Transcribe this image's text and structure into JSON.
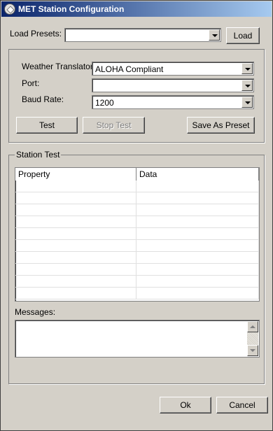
{
  "window": {
    "title": "MET Station Configuration"
  },
  "presets": {
    "label": "Load Presets:",
    "value": "",
    "load_button": "Load"
  },
  "config": {
    "weather_translator_label": "Weather Translator:",
    "weather_translator_value": "ALOHA Compliant",
    "port_label": "Port:",
    "port_value": "",
    "baud_rate_label": "Baud Rate:",
    "baud_rate_value": "1200",
    "test_button": "Test",
    "stop_test_button": "Stop Test",
    "save_preset_button": "Save As Preset"
  },
  "station_test": {
    "legend": "Station Test",
    "columns": [
      "Property",
      "Data"
    ],
    "row_count": 10,
    "messages_label": "Messages:"
  },
  "footer": {
    "ok_button": "Ok",
    "cancel_button": "Cancel"
  },
  "colors": {
    "window_bg": "#d4d0c8",
    "title_start": "#0a246a",
    "title_end": "#a6caf0"
  }
}
